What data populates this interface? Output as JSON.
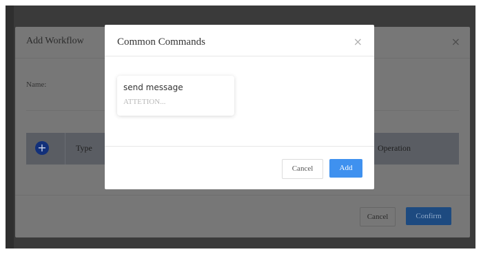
{
  "workflow_dialog": {
    "title": "Add Workflow",
    "close_glyph": "×",
    "name_label": "Name:",
    "table": {
      "add_glyph": "+",
      "type_header": "Type",
      "operation_header": "Operation"
    },
    "cancel_label": "Cancel",
    "confirm_label": "Confirm"
  },
  "commands_dialog": {
    "title": "Common Commands",
    "close_glyph": "×",
    "card": {
      "title": "send message",
      "subtitle": "ATTETION..."
    },
    "cancel_label": "Cancel",
    "add_label": "Add"
  },
  "colors": {
    "overlay": "#3a3a3a",
    "primary_button": "#3f91ef"
  }
}
